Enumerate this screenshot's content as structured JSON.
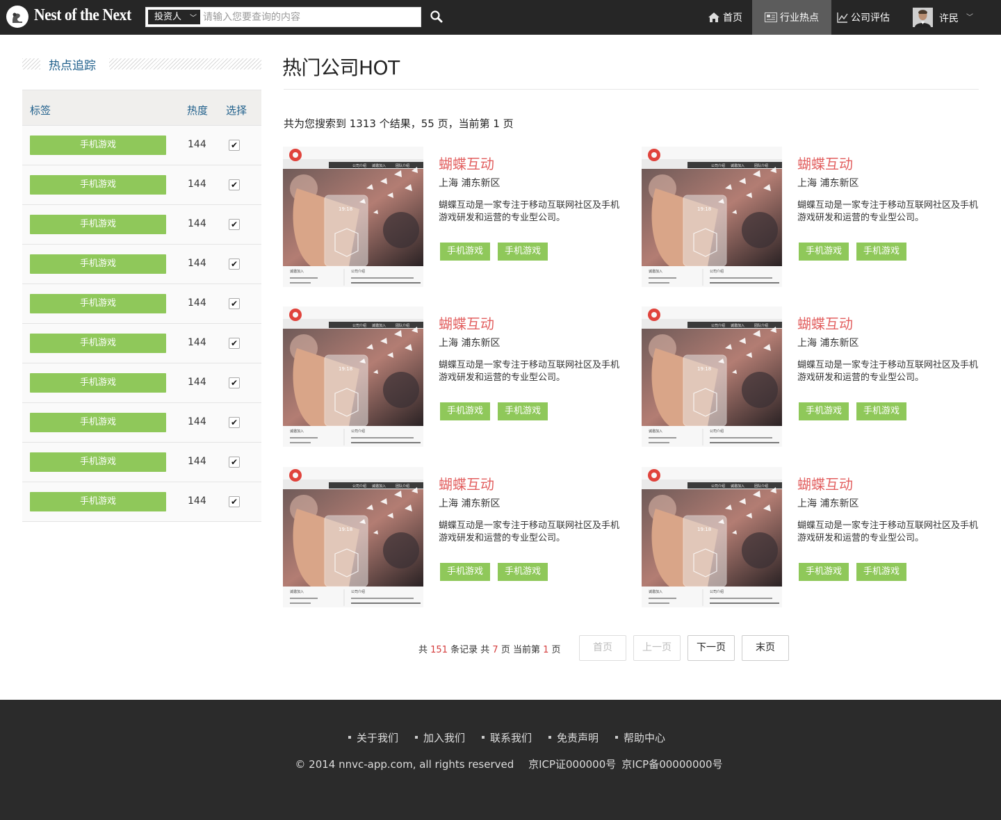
{
  "header": {
    "logo_text": "Nest of the Next",
    "search": {
      "type_label": "投资人",
      "placeholder": "请输入您要查询的内容",
      "value": ""
    },
    "nav": [
      {
        "label": "首页",
        "icon": "home-icon"
      },
      {
        "label": "行业热点",
        "icon": "newspaper-icon",
        "active": true
      },
      {
        "label": "公司评估",
        "icon": "chart-line-icon"
      }
    ],
    "user": {
      "name": "许民"
    },
    "active_nav_color": "#5c5c5c",
    "bar_color": "#262626"
  },
  "sidebar": {
    "title": "热点追踪",
    "columns": {
      "tag": "标签",
      "heat": "热度",
      "select": "选择"
    },
    "rows": [
      {
        "tag": "手机游戏",
        "heat": "144",
        "checked": true
      },
      {
        "tag": "手机游戏",
        "heat": "144",
        "checked": true
      },
      {
        "tag": "手机游戏",
        "heat": "144",
        "checked": true
      },
      {
        "tag": "手机游戏",
        "heat": "144",
        "checked": true
      },
      {
        "tag": "手机游戏",
        "heat": "144",
        "checked": true
      },
      {
        "tag": "手机游戏",
        "heat": "144",
        "checked": true
      },
      {
        "tag": "手机游戏",
        "heat": "144",
        "checked": true
      },
      {
        "tag": "手机游戏",
        "heat": "144",
        "checked": true
      },
      {
        "tag": "手机游戏",
        "heat": "144",
        "checked": true
      },
      {
        "tag": "手机游戏",
        "heat": "144",
        "checked": true
      }
    ],
    "check_mark": "✔",
    "tag_color": "#8fc85a"
  },
  "main": {
    "title": "热门公司HOT",
    "summary": "共为您搜索到 1313 个结果，55 页，当前第 1 页",
    "companies": [
      {
        "name": "蝴蝶互动",
        "location": "上海 浦东新区",
        "description": "蝴蝶互动是一家专注于移动互联网社区及手机游戏研发和运营的专业型公司。",
        "tags": [
          "手机游戏",
          "手机游戏"
        ]
      },
      {
        "name": "蝴蝶互动",
        "location": "上海 浦东新区",
        "description": "蝴蝶互动是一家专注于移动互联网社区及手机游戏研发和运营的专业型公司。",
        "tags": [
          "手机游戏",
          "手机游戏"
        ]
      },
      {
        "name": "蝴蝶互动",
        "location": "上海 浦东新区",
        "description": "蝴蝶互动是一家专注于移动互联网社区及手机游戏研发和运营的专业型公司。",
        "tags": [
          "手机游戏",
          "手机游戏"
        ]
      },
      {
        "name": "蝴蝶互动",
        "location": "上海 浦东新区",
        "description": "蝴蝶互动是一家专注于移动互联网社区及手机游戏研发和运营的专业型公司。",
        "tags": [
          "手机游戏",
          "手机游戏"
        ]
      },
      {
        "name": "蝴蝶互动",
        "location": "上海 浦东新区",
        "description": "蝴蝶互动是一家专注于移动互联网社区及手机游戏研发和运营的专业型公司。",
        "tags": [
          "手机游戏",
          "手机游戏"
        ]
      },
      {
        "name": "蝴蝶互动",
        "location": "上海 浦东新区",
        "description": "蝴蝶互动是一家专注于移动互联网社区及手机游戏研发和运营的专业型公司。",
        "tags": [
          "手机游戏",
          "手机游戏"
        ]
      }
    ],
    "thumb_texts": {
      "menu": [
        "公司介绍",
        "诚邀加入",
        "团队介绍"
      ],
      "time": "19:18",
      "foot_left": "诚邀加入",
      "foot_right": "公司介绍"
    },
    "company_name_color": "#e25f5f"
  },
  "pagination": {
    "info": {
      "prefix": "共",
      "records": "151",
      "records_suffix": "条记录 共",
      "pages": "7",
      "pages_suffix": "页 当前第",
      "current": "1",
      "current_suffix": "页"
    },
    "buttons": {
      "first": "首页",
      "prev": "上一页",
      "next": "下一页",
      "last": "末页"
    }
  },
  "footer": {
    "links": [
      "关于我们",
      "加入我们",
      "联系我们",
      "免责声明",
      "帮助中心"
    ],
    "copyright": "© 2014 nnvc-app.com, all rights reserved",
    "icp1": "京ICP证000000号",
    "icp2": "京ICP备00000000号"
  }
}
